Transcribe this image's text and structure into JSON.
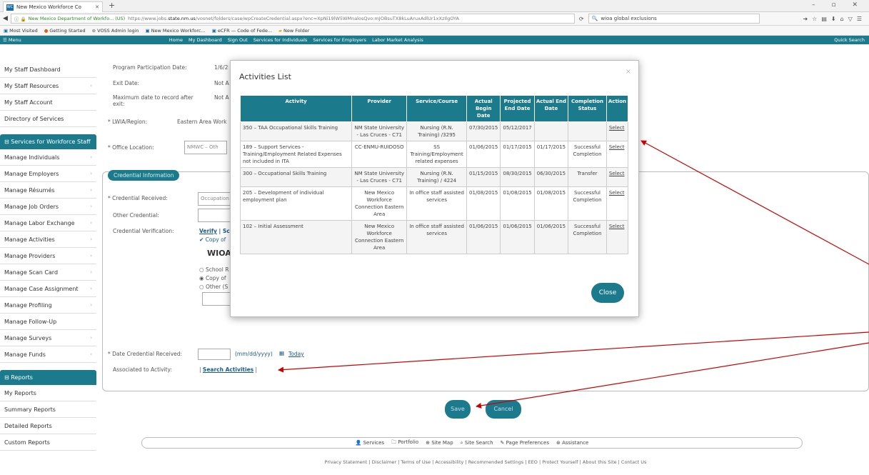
{
  "browser": {
    "tab_title": "New Mexico Workforce Co",
    "tab_favicon": "WC",
    "window_controls": "–  ▫  ✕",
    "identity": "New Mexico Department of Workfo... (US)",
    "url_prefix": "https://www.jobs.",
    "url_host": "state.nm.us",
    "url_rest": "/vosnet/folders/case/wpCreateCredential.aspx?enc=XpNi19lW5WMnalosQvo:mJOBsuTX8kLuAruxAdlUr1xXzIlgOYA",
    "search_value": "wioa global exclusions",
    "bookmarks": [
      "Most Visited",
      "Getting Started",
      "VOSS Admin login",
      "New Mexico Workforc...",
      "eCFR — Code of Fede...",
      "New Folder"
    ]
  },
  "site_nav": {
    "menu": "Menu",
    "links": [
      "Home",
      "My Dashboard",
      "Sign Out",
      "Services for Individuals",
      "Services for Employers",
      "Labor Market Analysis"
    ],
    "quick_search": "Quick Search"
  },
  "sidebar": {
    "items_top": [
      {
        "label": "My Staff Dashboard",
        "chev": false
      },
      {
        "label": "My Staff Resources",
        "chev": true
      },
      {
        "label": "My Staff Account",
        "chev": false
      },
      {
        "label": "Directory of Services",
        "chev": false
      }
    ],
    "section1": "Services for Workforce Staff",
    "items_mid": [
      {
        "label": "Manage Individuals",
        "chev": true
      },
      {
        "label": "Manage Employers",
        "chev": true
      },
      {
        "label": "Manage Résumés",
        "chev": true
      },
      {
        "label": "Manage Job Orders",
        "chev": true
      },
      {
        "label": "Manage Labor Exchange",
        "chev": true
      },
      {
        "label": "Manage Activities",
        "chev": true
      },
      {
        "label": "Manage Providers",
        "chev": true
      },
      {
        "label": "Manage Scan Card",
        "chev": true
      },
      {
        "label": "Manage Case Assignment",
        "chev": true
      },
      {
        "label": "Manage Profiling",
        "chev": true
      },
      {
        "label": "Manage Follow-Up",
        "chev": false
      },
      {
        "label": "Manage Surveys",
        "chev": true
      },
      {
        "label": "Manage Funds",
        "chev": true
      }
    ],
    "section2": "Reports",
    "items_bottom": [
      {
        "label": "My Reports"
      },
      {
        "label": "Summary Reports"
      },
      {
        "label": "Detailed Reports"
      },
      {
        "label": "Custom Reports"
      }
    ]
  },
  "form": {
    "program_participation_label": "Program Participation Date:",
    "program_participation_value": "1/6/2",
    "exit_date_label": "Exit Date:",
    "exit_date_value": "Not A",
    "max_date_label": "Maximum date to record after exit:",
    "max_date_value": "Not A",
    "lwia_label": "* LWIA/Region:",
    "lwia_value": "Eastern Area Work",
    "office_label": "* Office Location:",
    "office_value": "NMWC – Oth",
    "credential_legend": "Credential Information",
    "credential_received_label": "* Credential Received:",
    "credential_received_value": "Occupation",
    "other_credential_label": "Other Credential:",
    "verification_label": "Credential Verification:",
    "verify_link": "Verify",
    "verify_sep": " | Sc",
    "copy_of": "✔ Copy of",
    "wioa_heading": "WIOA C",
    "radio1": "School R",
    "radio2": "Copy of",
    "radio3": "Other (S",
    "date_received_label": "* Date Credential Received:",
    "date_format": "(mm/dd/yyyy)",
    "today_link": "Today",
    "associated_label": "Associated to Activity:",
    "search_activities": "Search Activities",
    "save": "Save",
    "cancel": "Cancel"
  },
  "footer": {
    "icons_row": [
      "Services",
      "Portfolio",
      "Site Map",
      "Site Search",
      "Page Preferences",
      "Assistance"
    ],
    "links": "Privacy Statement | Disclaimer | Terms of Use | Accessibility | Recommended Settings | EEO | Protect Yourself | About this Site | Contact Us"
  },
  "modal": {
    "title": "Activities List",
    "close_x": "×",
    "headers": [
      "Activity",
      "Provider",
      "Service/Course",
      "Actual Begin Date",
      "Projected End Date",
      "Actual End Date",
      "Completion Status",
      "Action"
    ],
    "rows": [
      [
        "350 – TAA Occupational Skills Training",
        "NM State University - Las Cruces - C71",
        "Nursing (R.N. Training) /3295",
        "07/30/2015",
        "05/12/2017",
        "",
        "",
        "Select"
      ],
      [
        "189 – Support Services - Training/Employment Related Expenses not included in ITA",
        "CC-ENMU-RUIDOSO",
        "SS Training/Employment related expenses",
        "01/06/2015",
        "01/17/2015",
        "01/17/2015",
        "Successful Completion",
        "Select"
      ],
      [
        "300 – Occupational Skills Training",
        "NM State University - Las Cruces - C71",
        "Nursing (R.N. Training) / 4224",
        "01/15/2015",
        "08/30/2015",
        "06/30/2015",
        "Transfer",
        "Select"
      ],
      [
        "205 – Development of individual employment plan",
        "New Mexico Workforce Connection Eastern Area",
        "In office staff assisted services",
        "01/08/2015",
        "01/08/2015",
        "01/08/2015",
        "Successful Completion",
        "Select"
      ],
      [
        "102 – Initial Assessment",
        "New Mexico Workforce Connection Eastern Area",
        "In office staff assisted services",
        "01/06/2015",
        "01/06/2015",
        "01/06/2015",
        "Successful Completion",
        "Select"
      ]
    ],
    "close_button": "Close"
  },
  "annotation_color": "#cc0000"
}
